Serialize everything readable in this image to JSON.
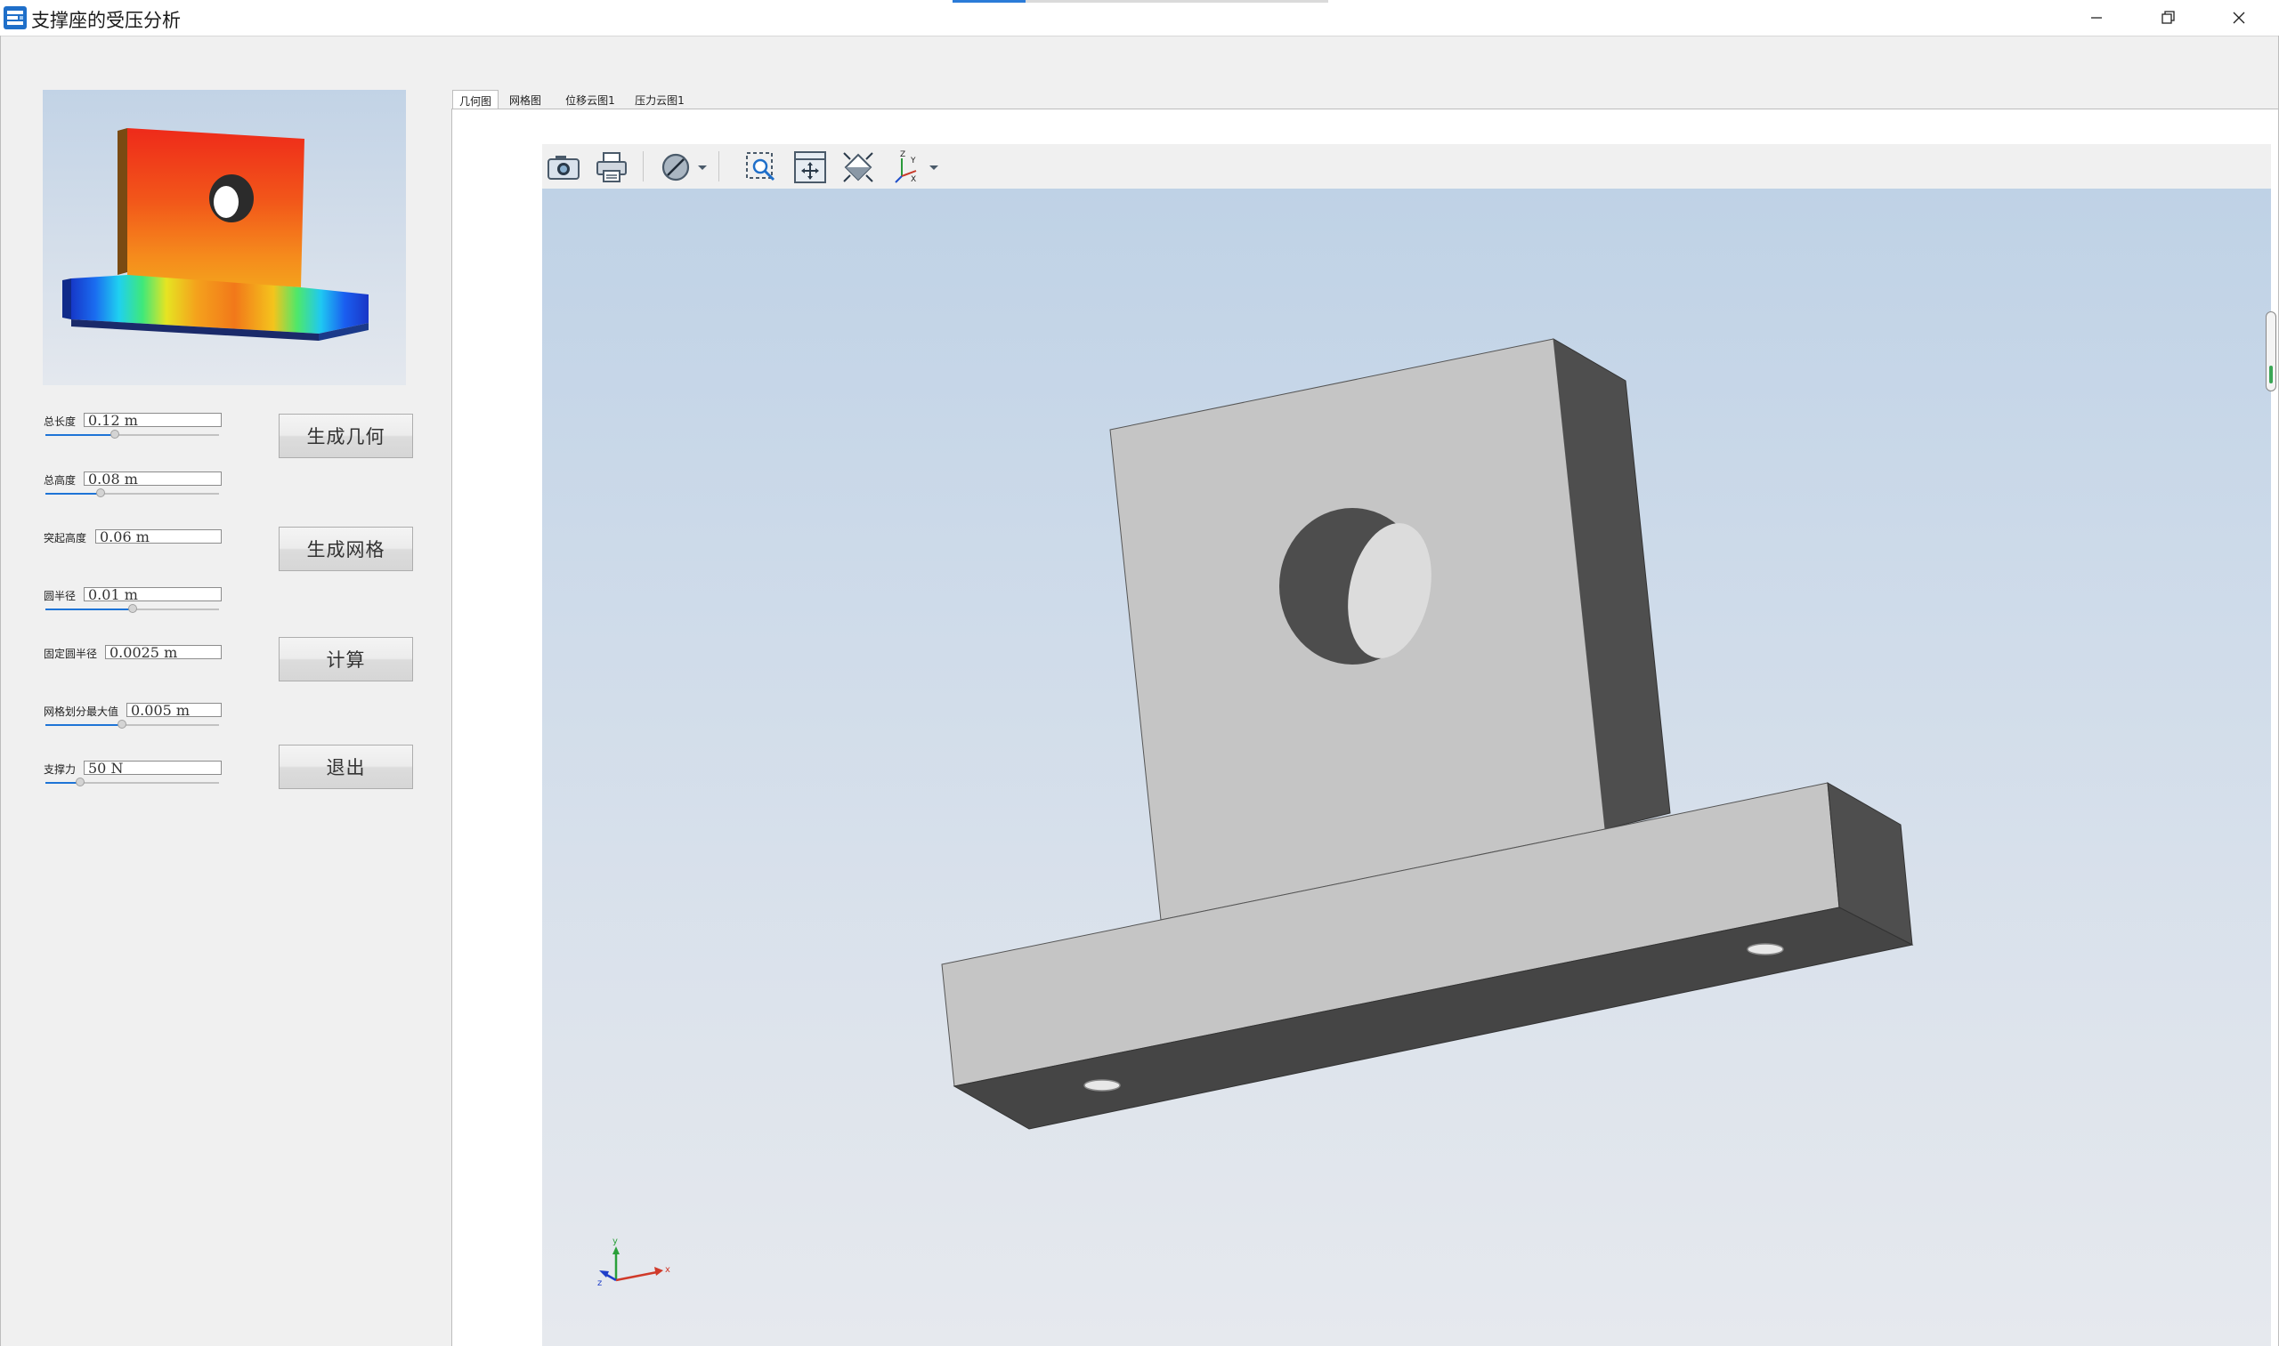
{
  "window": {
    "title": "支撑座的受压分析",
    "controls": [
      "minimize-icon",
      "restore-icon",
      "close-icon"
    ]
  },
  "preview": {
    "icon": "stress-result-thumbnail"
  },
  "params": [
    {
      "label": "总长度",
      "value": "0.12 m",
      "slider_fraction": 0.4
    },
    {
      "label": "总高度",
      "value": "0.08 m",
      "slider_fraction": 0.32
    },
    {
      "label": "突起高度",
      "value": "0.06 m"
    },
    {
      "label": "圆半径",
      "value": "0.01 m",
      "slider_fraction": 0.5
    },
    {
      "label": "固定圆半径",
      "value": "0.0025 m"
    },
    {
      "label": "网格划分最大值",
      "value": "0.005 m",
      "slider_fraction": 0.44
    },
    {
      "label": "支撑力",
      "value": "50 N",
      "slider_fraction": 0.2
    }
  ],
  "buttons": {
    "generate_geometry": "生成几何",
    "generate_mesh": "生成网格",
    "compute": "计算",
    "exit": "退出"
  },
  "tabs": [
    {
      "label": "几何图",
      "active": true
    },
    {
      "label": "网格图",
      "active": false
    },
    {
      "label": "位移云图1",
      "active": false
    },
    {
      "label": "压力云图1",
      "active": false
    }
  ],
  "toolbar": [
    "camera-icon",
    "print-icon",
    "render-mode-icon",
    "dropdown-arrow-icon",
    "zoom-box-icon",
    "fit-extents-icon",
    "view-orient-icon",
    "axis-triad-icon",
    "dropdown-arrow-icon"
  ],
  "axis_triad": {
    "x": "x",
    "y": "y",
    "z": "z"
  },
  "colors": {
    "accent": "#1e74d6",
    "viewport_top": "#bfd2e6",
    "viewport_bottom": "#e6e9ee",
    "model_face": "#c4c4c4",
    "model_dark": "#4e4e4e"
  }
}
